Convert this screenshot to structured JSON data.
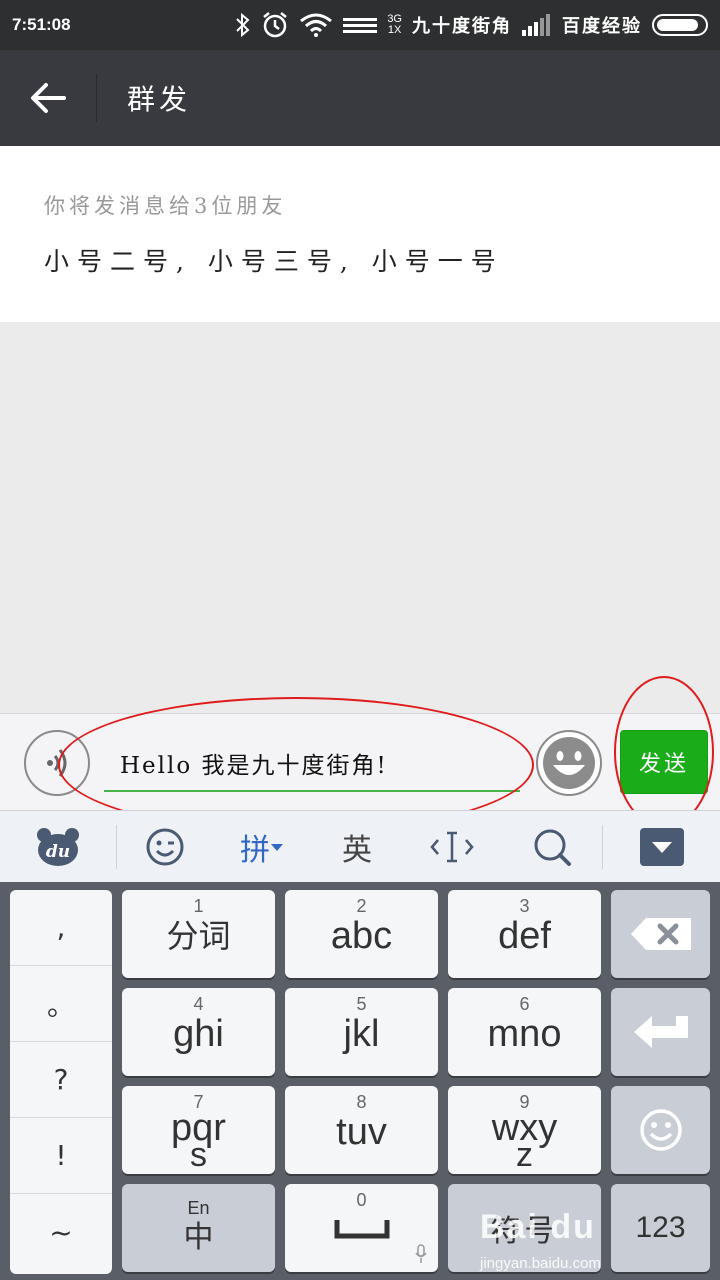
{
  "status_bar": {
    "time": "7:51:08",
    "network_type_top": "3G",
    "network_type_bottom": "1X",
    "carrier_1": "九十度街角",
    "carrier_2": "百度经验",
    "battery_level": 0.9
  },
  "header": {
    "title": "群发"
  },
  "recipients": {
    "hint": "你将发消息给3位朋友",
    "names": "小号二号, 小号三号, 小号一号"
  },
  "input_bar": {
    "message_value": "Hello 我是九十度街角!",
    "send_label": "发送"
  },
  "keyboard_toolbar": {
    "pinyin_label": "拼",
    "english_label": "英"
  },
  "keyboard": {
    "punctuation": [
      ",",
      "。",
      "?",
      "!",
      "~"
    ],
    "keys": [
      {
        "num": "1",
        "main": "分词",
        "sub": ""
      },
      {
        "num": "2",
        "main": "abc",
        "sub": ""
      },
      {
        "num": "3",
        "main": "def",
        "sub": ""
      },
      {
        "num": "4",
        "main": "ghi",
        "sub": ""
      },
      {
        "num": "5",
        "main": "jkl",
        "sub": ""
      },
      {
        "num": "6",
        "main": "mno",
        "sub": ""
      },
      {
        "num": "7",
        "main": "pqr",
        "sub": "s"
      },
      {
        "num": "8",
        "main": "tuv",
        "sub": ""
      },
      {
        "num": "9",
        "main": "wxy",
        "sub": "z"
      }
    ],
    "lang_key_top": "En",
    "lang_key_main": "中",
    "space_num": "0",
    "symbol_label": "符号",
    "numeric_label": "123"
  },
  "watermark": {
    "logo": "Bai du",
    "url": "jingyan.baidu.com"
  },
  "colors": {
    "send_green": "#1aad19",
    "header_bg": "#393a3f",
    "annotation_red": "#e01b1b",
    "pinyin_blue": "#3367c6"
  }
}
